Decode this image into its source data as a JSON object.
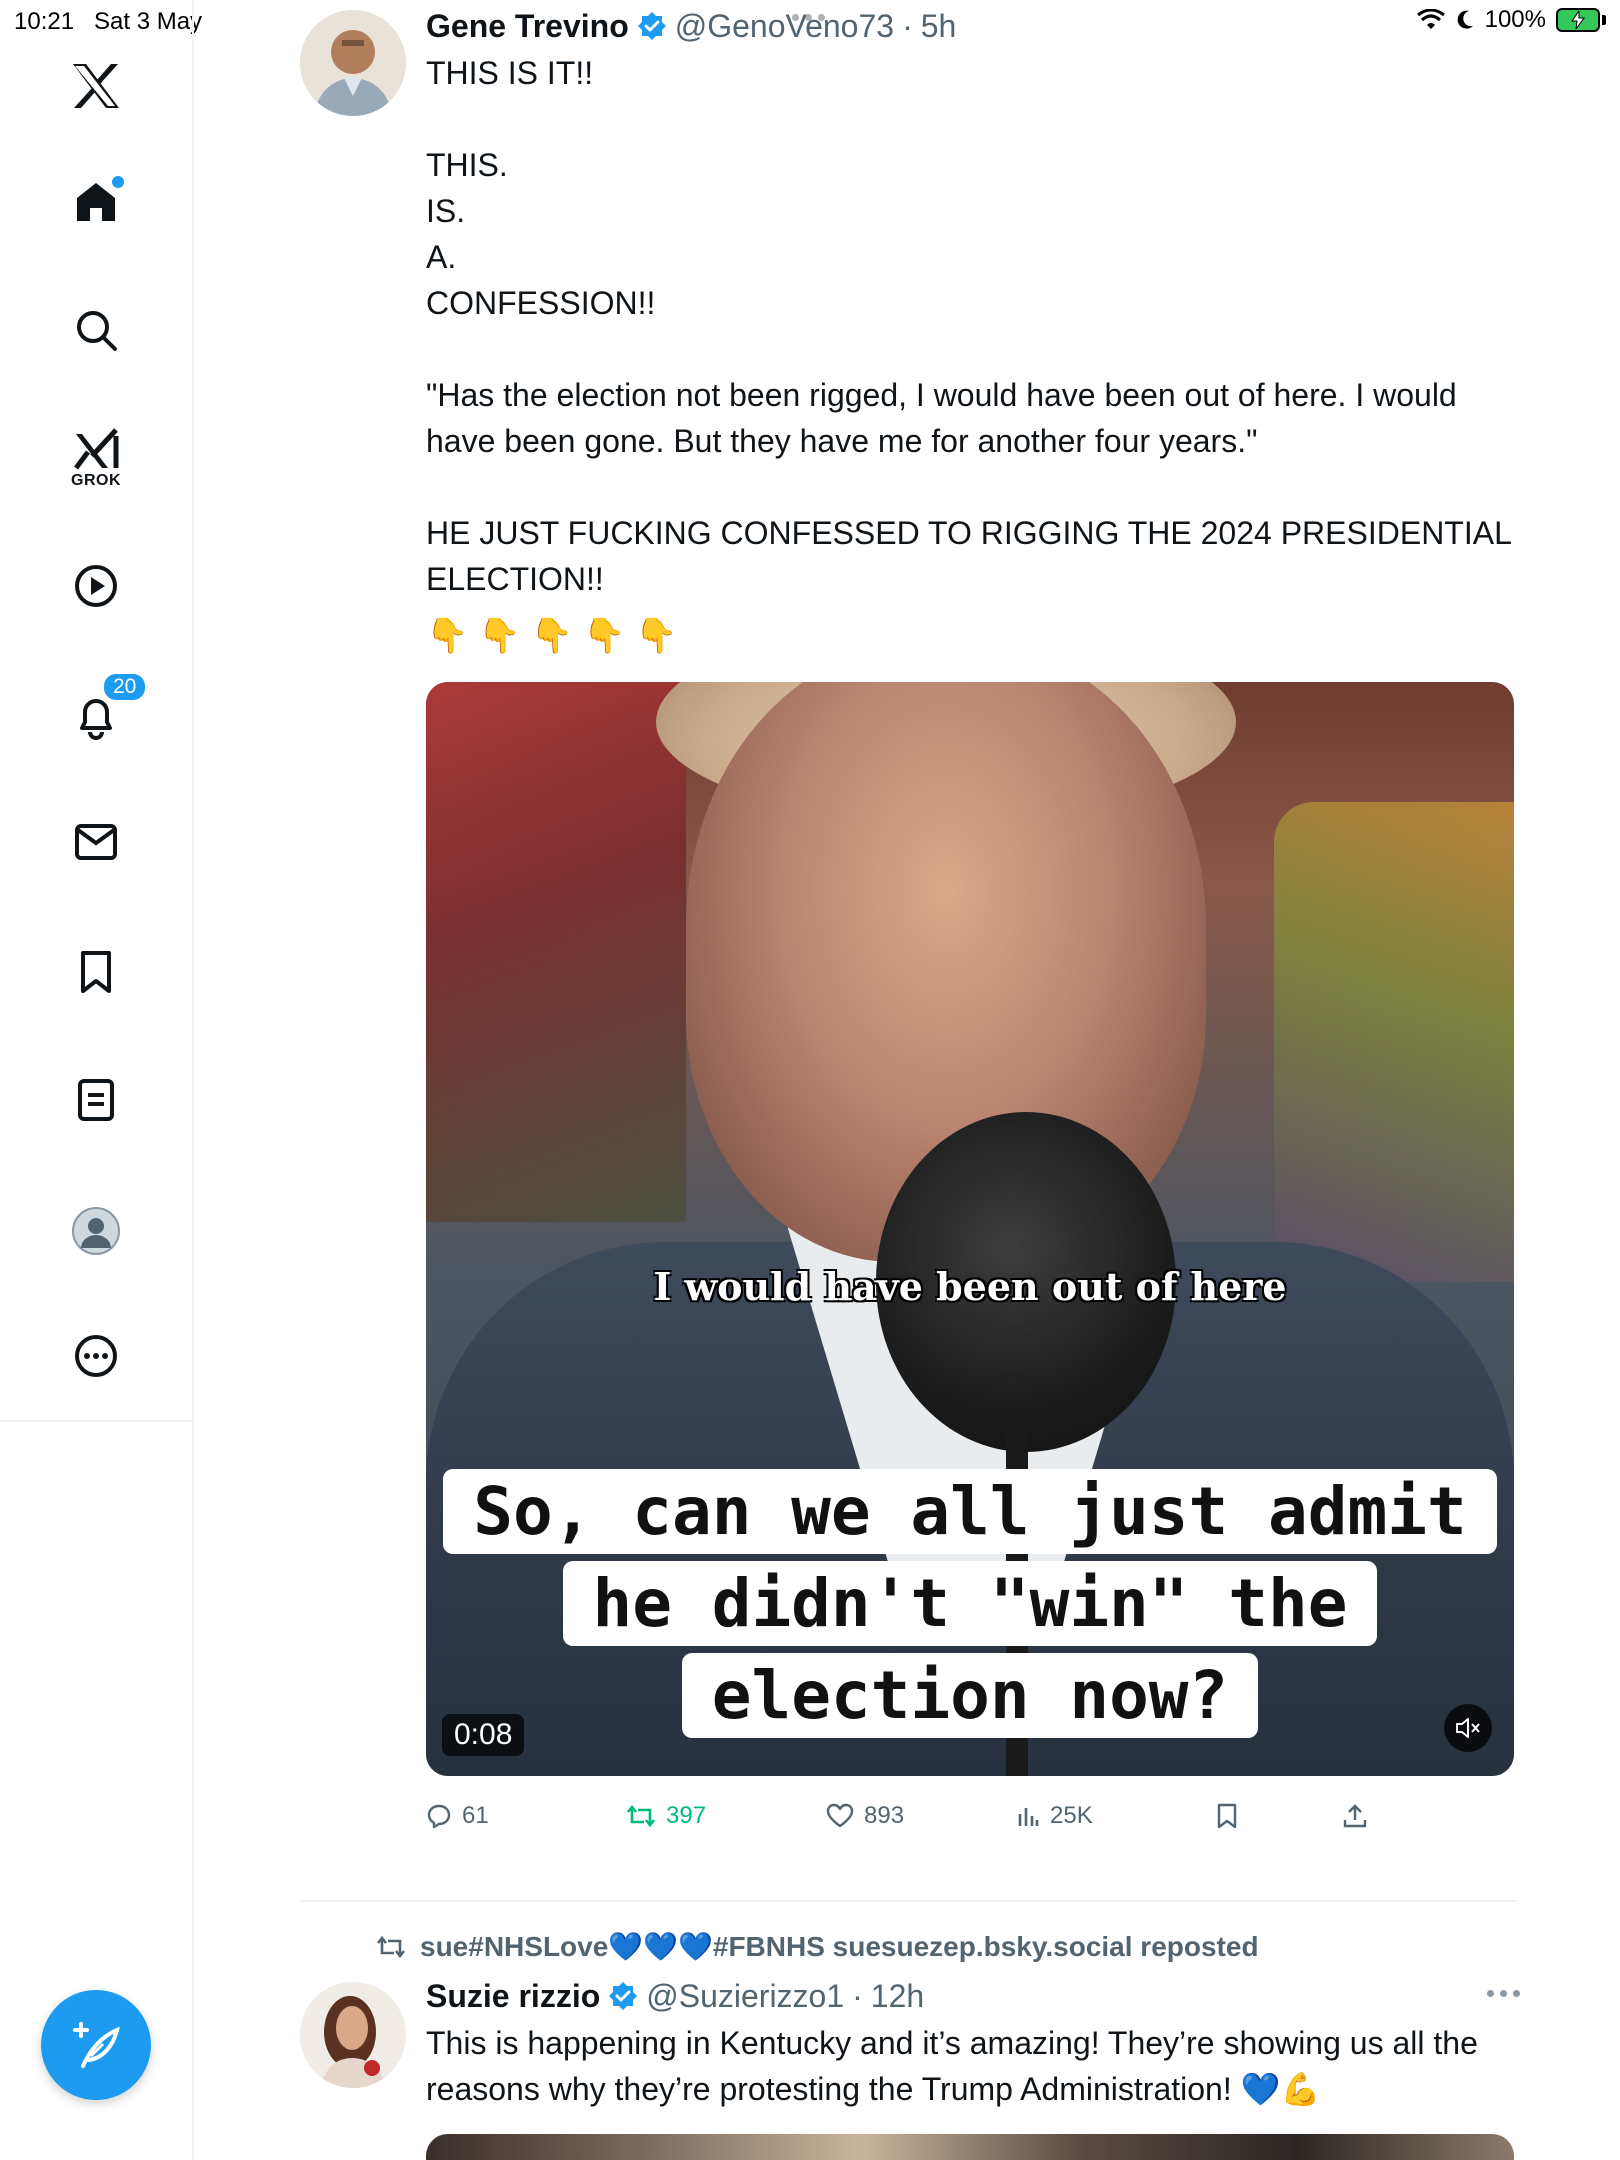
{
  "status_bar": {
    "time": "10:21",
    "date": "Sat 3 May",
    "battery": "100%"
  },
  "sidebar": {
    "grok_label": "GROK",
    "notifications_count": "20"
  },
  "tweets": [
    {
      "name": "Gene Trevino",
      "handle": "@GenoVeno73",
      "sep": "·",
      "ago": "5h",
      "text": "THIS IS IT!!\n\nTHIS.\nIS.\nA.\nCONFESSION!!\n\n\"Has the election not been rigged, I would have been out of here. I would have been gone. But they have me for another four years.\"\n\nHE JUST FUCKING CONFESSED TO RIGGING THE 2024 PRESIDENTIAL ELECTION!!",
      "emojis": "👇👇👇👇👇",
      "media": {
        "caption_top": "I would have been out of here",
        "caption_main": "So, can we all just admit he didn't \"win\" the election now?",
        "duration": "0:08"
      },
      "stats": {
        "replies": "61",
        "reposts": "397",
        "likes": "893",
        "views": "25K"
      }
    },
    {
      "repost_by": "sue#NHSLove💙💙💙#FBNHS suesuezep.bsky.social reposted",
      "name": "Suzie rizzio",
      "handle": "@Suzierizzo1",
      "sep": "·",
      "ago": "12h",
      "text": "This is happening in Kentucky and it’s amazing! They’re showing us all the reasons why they’re protesting the Trump Administration! 💙💪"
    }
  ],
  "colors": {
    "accent": "#1d9bf0",
    "retweet": "#00ba7c",
    "muted": "#536471"
  }
}
